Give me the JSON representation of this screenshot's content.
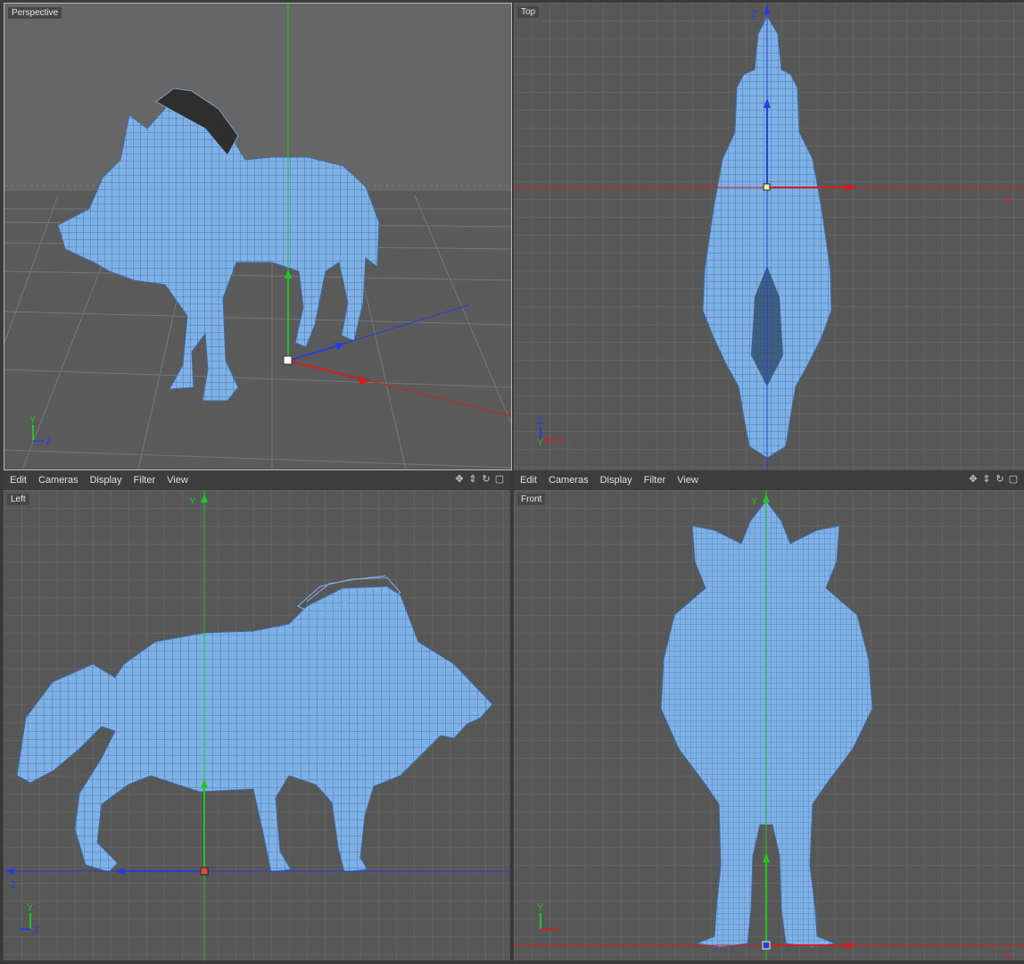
{
  "viewports": {
    "perspective": {
      "label": "Perspective"
    },
    "top": {
      "label": "Top"
    },
    "left": {
      "label": "Left"
    },
    "front": {
      "label": "Front"
    }
  },
  "menubar": {
    "items": [
      "Edit",
      "Cameras",
      "Display",
      "Filter",
      "View"
    ]
  },
  "nav_icons": [
    "move-view-icon",
    "dolly-view-icon",
    "rotate-view-icon",
    "maximize-view-icon"
  ],
  "axis_labels": {
    "x": "X",
    "y": "Y",
    "z": "Z"
  },
  "colors": {
    "wireframe": "#7fb1e6",
    "wire_line": "#365f90",
    "grid_line": "#6a6a6a",
    "axis_x": "#d21e1e",
    "axis_y": "#22c322",
    "axis_z": "#2a3ed6",
    "viewport_bg": "#575757"
  }
}
